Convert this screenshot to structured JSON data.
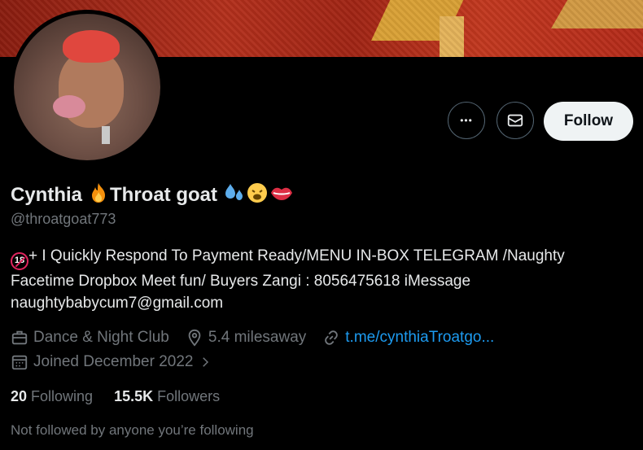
{
  "profile": {
    "name": "Cynthia",
    "name_suffix": "Throat goat",
    "handle": "@throatgoat773",
    "bio_line1": "+ I Quickly Respond To Payment Ready/MENU IN-BOX TELEGRAM /Naughty",
    "bio_line2": "Facetime Dropbox Meet fun/ Buyers Zangi : 8056475618 iMessage",
    "bio_line3": "naughtybabycum7@gmail.com",
    "age_badge": "18",
    "emojis": [
      "fire",
      "sweat-droplets",
      "weary-face",
      "lips"
    ]
  },
  "actions": {
    "more_label": "•••",
    "follow_label": "Follow"
  },
  "meta": {
    "category": "Dance & Night Club",
    "location": "5.4 milesaway",
    "link": "t.me/cynthiaTroatgo...",
    "joined": "Joined December 2022"
  },
  "counts": {
    "following_value": "20",
    "following_label": "Following",
    "followers_value": "15.5K",
    "followers_label": "Followers"
  },
  "followed_note": "Not followed by anyone you’re following",
  "colors": {
    "accent": "#1d9bf0",
    "muted": "#71767b",
    "text": "#e7e9ea",
    "background": "#000000"
  }
}
